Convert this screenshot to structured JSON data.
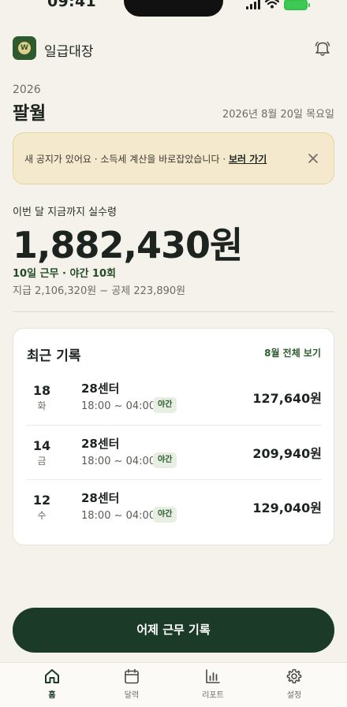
{
  "status_bar": {
    "time": "09:41"
  },
  "header": {
    "app_name": "일급대장",
    "logo_letter": "W"
  },
  "period": {
    "year": "2026",
    "month": "팔월",
    "date_full": "2026년 8월 20일 목요일"
  },
  "notice": {
    "text": "새 공지가 있어요 · 소득세 계산을 바로잡았습니다 · ",
    "link": "보러 가기"
  },
  "earnings": {
    "label": "이번 달 지금까지 실수령",
    "amount": "1,882,430원",
    "count": "10일 근무 · 야간 10회",
    "detail": "지급 2,106,320원 − 공제 223,890원"
  },
  "recent": {
    "title": "최근 기록",
    "link": "8월 전체 보기",
    "rows": [
      {
        "day": "18",
        "dow": "화",
        "place": "28센터",
        "time": "18:00 ~ 04:00",
        "tag": "야간",
        "wage": "127,640원"
      },
      {
        "day": "14",
        "dow": "금",
        "place": "28센터",
        "time": "18:00 ~ 04:00",
        "tag": "야간",
        "wage": "209,940원"
      },
      {
        "day": "12",
        "dow": "수",
        "place": "28센터",
        "time": "18:00 ~ 04:00",
        "tag": "야간",
        "wage": "129,040원"
      }
    ]
  },
  "cta": {
    "label": "어제 근무 기록"
  },
  "tabs": [
    {
      "label": "홈",
      "icon": "home-icon",
      "active": true
    },
    {
      "label": "달력",
      "icon": "calendar-icon",
      "active": false
    },
    {
      "label": "리포트",
      "icon": "bar-chart-icon",
      "active": false
    },
    {
      "label": "설정",
      "icon": "gear-icon",
      "active": false
    }
  ],
  "colors": {
    "brand": "#1b3a27",
    "accent": "#2b5e2c",
    "background": "#f4f2eb",
    "notice_bg": "#f4e9cc"
  }
}
